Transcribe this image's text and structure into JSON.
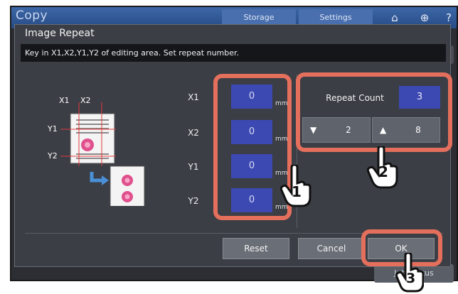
{
  "app": {
    "title": "Copy",
    "tabs": [
      "Storage",
      "Settings"
    ],
    "job_status_label": "Job Status"
  },
  "dialog": {
    "title": "Image Repeat",
    "message": "Key in X1,X2,Y1,Y2 of editing area. Set repeat number.",
    "illustration": {
      "x1": "X1",
      "x2": "X2",
      "y1": "Y1",
      "y2": "Y2"
    },
    "fields": [
      {
        "label": "X1",
        "value": "0",
        "unit": "mm"
      },
      {
        "label": "X2",
        "value": "0",
        "unit": "mm"
      },
      {
        "label": "Y1",
        "value": "0",
        "unit": "mm"
      },
      {
        "label": "Y2",
        "value": "0",
        "unit": "mm"
      }
    ],
    "repeat_count": {
      "label": "Repeat Count",
      "value": "3",
      "decrease_value": "2",
      "increase_value": "8"
    },
    "buttons": {
      "reset": "Reset",
      "cancel": "Cancel",
      "ok": "OK"
    }
  },
  "annotations": {
    "step1": "1",
    "step2": "2",
    "step3": "3"
  },
  "colors": {
    "highlight": "#e46f5c",
    "value_box": "#3d49b2",
    "dialog_bg": "#3b3e45"
  },
  "icons": [
    "home-icon",
    "globe-icon",
    "help-icon",
    "down-arrow-icon",
    "up-arrow-icon",
    "hand-pointer-icon"
  ]
}
